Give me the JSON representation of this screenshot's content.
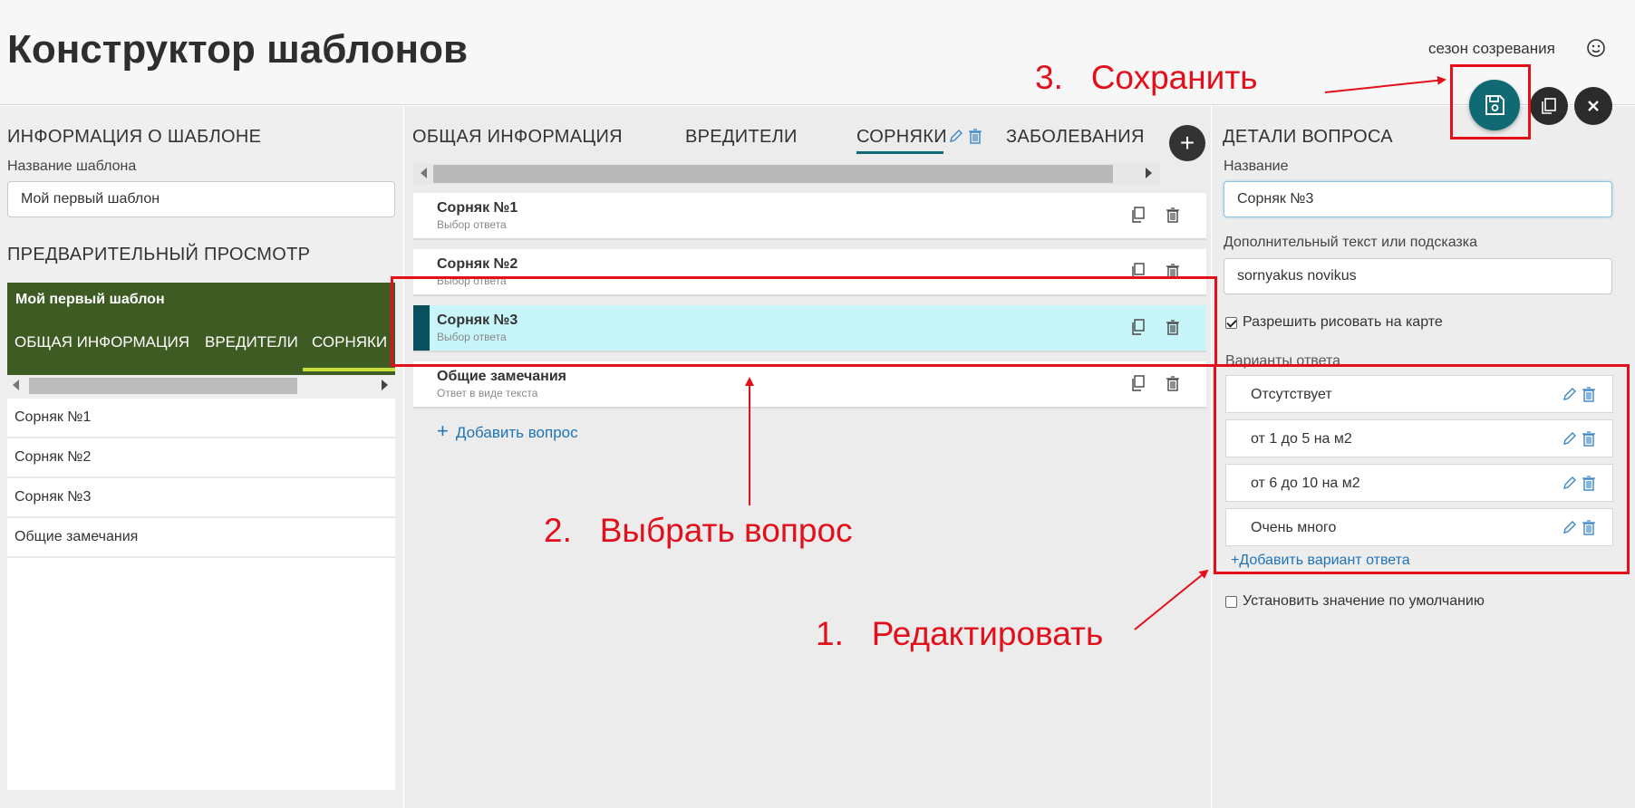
{
  "header": {
    "title": "Конструктор шаблонов",
    "season": "сезон созревания"
  },
  "left": {
    "info_heading": "ИНФОРМАЦИЯ О ШАБЛОНЕ",
    "name_label": "Название шаблона",
    "name_value": "Мой первый шаблон",
    "preview_heading": "ПРЕДВАРИТЕЛЬНЫЙ ПРОСМОТР",
    "preview": {
      "title": "Мой первый шаблон",
      "tabs": [
        "ОБЩАЯ ИНФОРМАЦИЯ",
        "ВРЕДИТЕЛИ",
        "СОРНЯКИ"
      ],
      "items": [
        "Сорняк №1",
        "Сорняк №2",
        "Сорняк №3",
        "Общие замечания"
      ]
    }
  },
  "middle": {
    "tabs": [
      "ОБЩАЯ ИНФОРМАЦИЯ",
      "ВРЕДИТЕЛИ",
      "СОРНЯКИ",
      "ЗАБОЛЕВАНИЯ"
    ],
    "active_tab": "СОРНЯКИ",
    "questions": [
      {
        "title": "Сорняк №1",
        "subtitle": "Выбор ответа"
      },
      {
        "title": "Сорняк №2",
        "subtitle": "Выбор ответа"
      },
      {
        "title": "Сорняк №3",
        "subtitle": "Выбор ответа"
      },
      {
        "title": "Общие замечания",
        "subtitle": "Ответ в виде текста"
      }
    ],
    "add_question": "Добавить вопрос"
  },
  "right": {
    "heading": "ДЕТАЛИ ВОПРОСА",
    "name_label": "Название",
    "name_value": "Сорняк №3",
    "hint_label": "Дополнительный текст или подсказка",
    "hint_value": "sornyakus novikus",
    "allow_draw": "Разрешить рисовать на карте",
    "options_label": "Варианты ответа",
    "options": [
      "Отсутствует",
      "от 1 до 5 на м2",
      "от 6 до 10 на м2",
      "Очень много"
    ],
    "add_option": "+Добавить вариант ответа",
    "default_value": "Установить значение по умолчанию"
  },
  "annotations": {
    "save": "3.   Сохранить",
    "select": "2.   Выбрать вопрос",
    "edit": "1.   Редактировать"
  },
  "colors": {
    "teal": "#0f6a74",
    "annotation_red": "#e3101c",
    "preview_green": "#3e5b23",
    "link_blue": "#1f74b8"
  }
}
